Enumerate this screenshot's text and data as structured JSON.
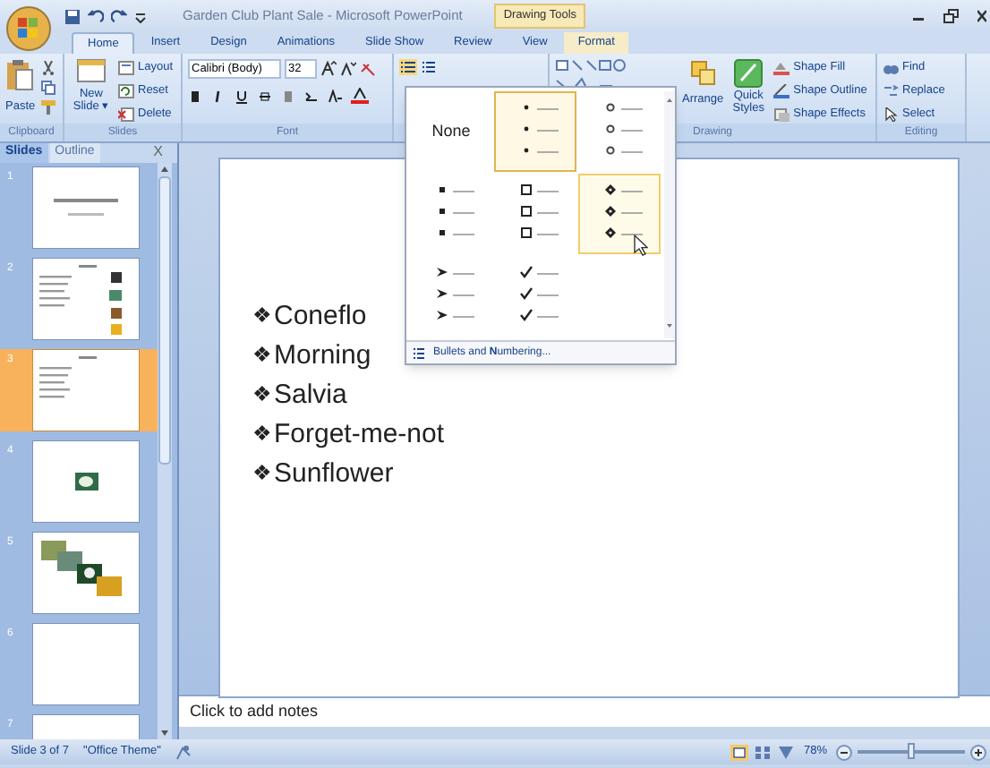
{
  "window": {
    "title": "Garden Club Plant Sale - Microsoft PowerPoint",
    "contextual_tab": "Drawing Tools"
  },
  "tabs": [
    {
      "label": "Home",
      "selected": true
    },
    {
      "label": "Insert",
      "selected": false
    },
    {
      "label": "Design",
      "selected": false
    },
    {
      "label": "Animations",
      "selected": false
    },
    {
      "label": "Slide Show",
      "selected": false
    },
    {
      "label": "Review",
      "selected": false
    },
    {
      "label": "View",
      "selected": false
    },
    {
      "label": "Format",
      "selected": false,
      "contextual": true
    }
  ],
  "ribbon": {
    "clipboard": {
      "paste": "Paste",
      "label": "Clipboard"
    },
    "slides": {
      "new_slide": "New Slide",
      "caret": "▾",
      "layout": "Layout",
      "reset": "Reset",
      "delete": "Delete",
      "label": "Slides"
    },
    "font": {
      "family": "Calibri (Body)",
      "size": "32",
      "label": "Font"
    },
    "drawing": {
      "arrange": "Arrange",
      "quick_styles": "Quick Styles",
      "shape_fill": "Shape Fill",
      "shape_outline": "Shape Outline",
      "shape_effects": "Shape Effects",
      "label": "Drawing"
    },
    "editing": {
      "find": "Find",
      "replace": "Replace",
      "select": "Select",
      "label": "Editing"
    }
  },
  "pane_tabs": [
    {
      "label": "Slides",
      "selected": true
    },
    {
      "label": "Outline",
      "selected": false
    }
  ],
  "pane_close": "X",
  "thumbnails": [
    {
      "number": "1",
      "kind": "title",
      "selected": false
    },
    {
      "number": "2",
      "kind": "list_pictures",
      "selected": false
    },
    {
      "number": "3",
      "kind": "list",
      "selected": true
    },
    {
      "number": "4",
      "kind": "picture",
      "selected": false
    },
    {
      "number": "5",
      "kind": "collage",
      "selected": false
    },
    {
      "number": "6",
      "kind": "blank",
      "selected": false
    },
    {
      "number": "7",
      "kind": "blank",
      "selected": false
    }
  ],
  "slide": {
    "bullet": "❖",
    "items": [
      "Coneflo",
      "Morning",
      "Salvia",
      "Forget-me-not",
      "Sunflower"
    ]
  },
  "bullet_menu": {
    "options": [
      {
        "kind": "none",
        "label": "None",
        "selected": false,
        "hovered": false
      },
      {
        "kind": "dot",
        "selected": true,
        "hovered": false
      },
      {
        "kind": "circle",
        "selected": false,
        "hovered": false
      },
      {
        "kind": "square",
        "selected": false,
        "hovered": false
      },
      {
        "kind": "box",
        "selected": false,
        "hovered": false
      },
      {
        "kind": "diamond",
        "selected": false,
        "hovered": true
      },
      {
        "kind": "arrow",
        "selected": false,
        "hovered": false
      },
      {
        "kind": "check",
        "selected": false,
        "hovered": false
      }
    ],
    "footer": "Bullets and **N**umbering..."
  },
  "notes": {
    "placeholder": "Click to add notes"
  },
  "status_bar": {
    "slide": "Slide 3 of 7",
    "theme": "\"Office Theme\"",
    "zoom": "78%",
    "zoom_level": {
      "level": 0.5
    }
  }
}
